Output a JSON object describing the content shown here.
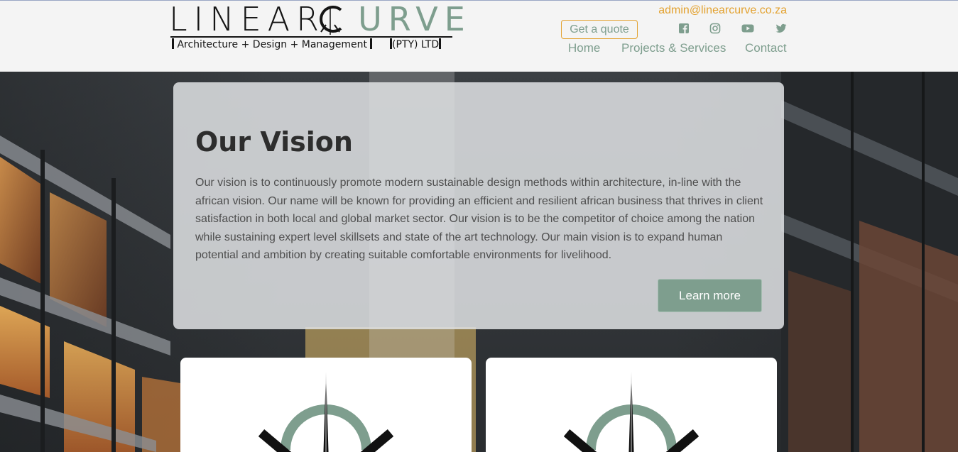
{
  "brand": {
    "wordmark_dark": "LINEAR",
    "wordmark_green": "URVE",
    "tagline_left": "Architecture + Design + Management",
    "tagline_right": "(PTY) LTD",
    "color_green": "#7e9e8e",
    "color_orange": "#e3a230"
  },
  "header": {
    "email": "admin@linearcurve.co.za",
    "quote_label": "Get a quote",
    "social_icons": [
      "facebook-icon",
      "instagram-icon",
      "youtube-icon",
      "twitter-icon"
    ]
  },
  "nav": [
    {
      "label": "Home"
    },
    {
      "label": "Projects & Services"
    },
    {
      "label": "Contact"
    }
  ],
  "vision": {
    "title": "Our Vision",
    "body": "Our vision is to continuously promote modern sustainable design methods within architecture, in-line with the african vision. Our name will be known for providing an efficient and resilient african business that thrives in client satisfaction in both local and global market sector. Our vision is to be the competitor of choice among the nation while sustaining expert level skillsets and state of the art technology. Our main vision is to expand human potential and ambition by creating suitable comfortable environments for livelihood.",
    "button_label": "Learn more"
  },
  "cards": [
    {
      "icon": "compass-logo-icon"
    },
    {
      "icon": "compass-logo-icon"
    }
  ]
}
